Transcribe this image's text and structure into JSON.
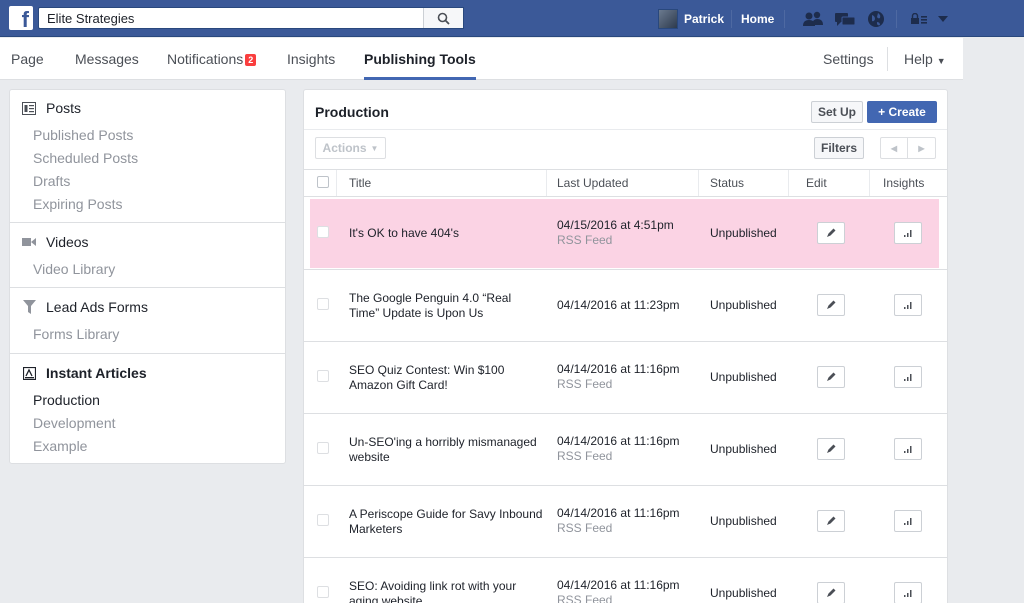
{
  "topbar": {
    "search_value": "Elite Strategies",
    "user_name": "Patrick",
    "home_label": "Home"
  },
  "page_nav": {
    "tabs": [
      {
        "label": "Page"
      },
      {
        "label": "Messages"
      },
      {
        "label": "Notifications",
        "badge": "2"
      },
      {
        "label": "Insights"
      },
      {
        "label": "Publishing Tools"
      }
    ],
    "settings_label": "Settings",
    "help_label": "Help"
  },
  "sidebar": {
    "posts": {
      "title": "Posts",
      "items": [
        "Published Posts",
        "Scheduled Posts",
        "Drafts",
        "Expiring Posts"
      ]
    },
    "videos": {
      "title": "Videos",
      "items": [
        "Video Library"
      ]
    },
    "lead_ads": {
      "title": "Lead Ads Forms",
      "items": [
        "Forms Library"
      ]
    },
    "instant_articles": {
      "title": "Instant Articles",
      "items": [
        "Production",
        "Development",
        "Example"
      ]
    }
  },
  "main": {
    "title": "Production",
    "setup_label": "Set Up",
    "create_label": "+ Create",
    "actions_label": "Actions",
    "filters_label": "Filters",
    "columns": [
      "Title",
      "Last Updated",
      "Status",
      "Edit",
      "Insights"
    ],
    "rows": [
      {
        "title": "It's OK to have 404's",
        "date": "04/15/2016 at 4:51pm",
        "source": "RSS Feed",
        "status": "Unpublished",
        "highlighted": true
      },
      {
        "title": "The Google Penguin 4.0 “Real Time” Update is Upon Us",
        "date": "04/14/2016 at 11:23pm",
        "source": "",
        "status": "Unpublished",
        "highlighted": false
      },
      {
        "title": "SEO Quiz Contest: Win $100 Amazon Gift Card!",
        "date": "04/14/2016 at 11:16pm",
        "source": "RSS Feed",
        "status": "Unpublished",
        "highlighted": false
      },
      {
        "title": "Un-SEO'ing a horribly mismanaged website",
        "date": "04/14/2016 at 11:16pm",
        "source": "RSS Feed",
        "status": "Unpublished",
        "highlighted": false
      },
      {
        "title": "A Periscope Guide for Savy Inbound Marketers",
        "date": "04/14/2016 at 11:16pm",
        "source": "RSS Feed",
        "status": "Unpublished",
        "highlighted": false
      },
      {
        "title": "SEO: Avoiding link rot with your aging website",
        "date": "04/14/2016 at 11:16pm",
        "source": "RSS Feed",
        "status": "Unpublished",
        "highlighted": false
      }
    ]
  },
  "colors": {
    "brand_blue": "#3b5998",
    "primary_button": "#4267b2",
    "highlight_row": "#fbd3e4",
    "badge_red": "#fa3e3e"
  }
}
